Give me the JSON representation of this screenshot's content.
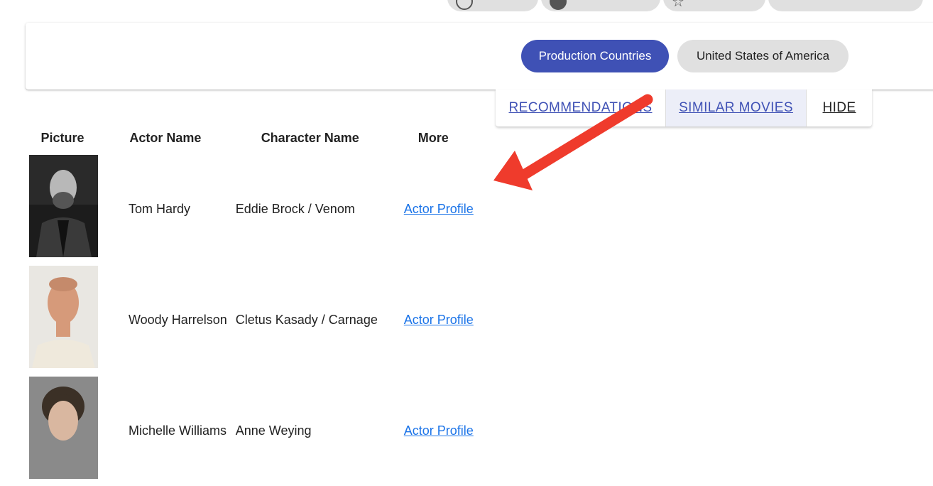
{
  "card": {
    "chip_label": "Production Countries",
    "chip_value": "United States of America"
  },
  "actions": {
    "recommendations": "RECOMMENDATIONS",
    "similar": "SIMILAR MOVIES",
    "hide": "HIDE"
  },
  "table": {
    "headers": [
      "Picture",
      "Actor Name",
      "Character Name",
      "More"
    ],
    "rows": [
      {
        "actor": "Tom Hardy",
        "character": "Eddie Brock / Venom",
        "link": "Actor Profile"
      },
      {
        "actor": "Woody Harrelson",
        "character": "Cletus Kasady / Carnage",
        "link": "Actor Profile"
      },
      {
        "actor": "Michelle Williams",
        "character": "Anne Weying",
        "link": "Actor Profile"
      }
    ]
  },
  "colors": {
    "primary": "#3f51b5",
    "link": "#1a73e8",
    "annotation_arrow": "#ef3b2c"
  }
}
